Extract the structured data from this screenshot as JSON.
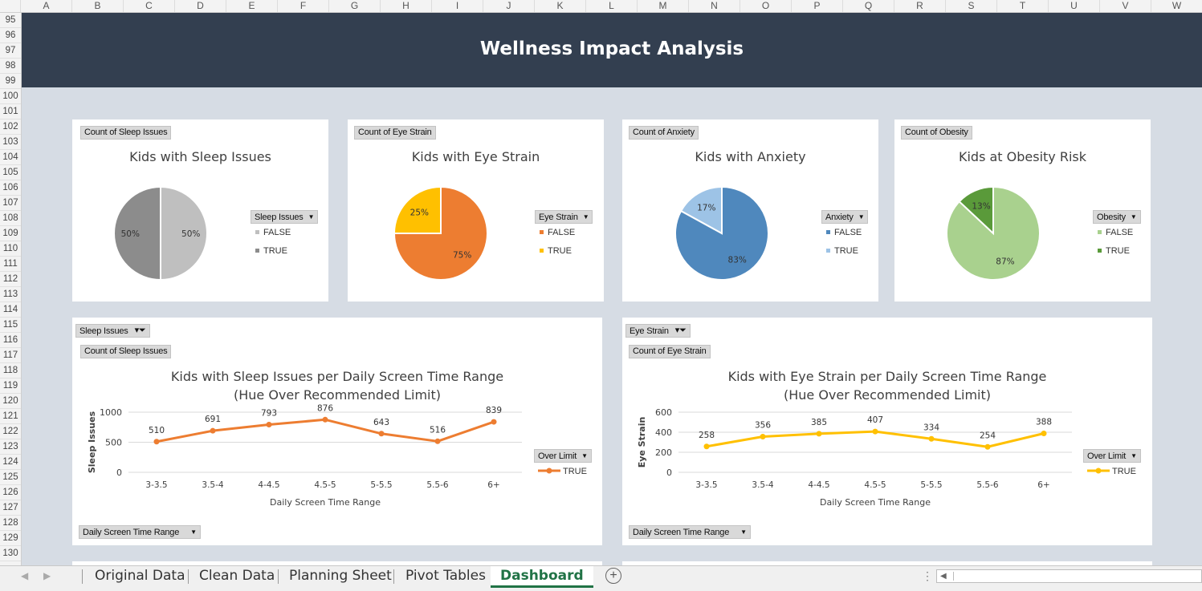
{
  "columns": [
    "A",
    "B",
    "C",
    "D",
    "E",
    "F",
    "G",
    "H",
    "I",
    "J",
    "K",
    "L",
    "M",
    "N",
    "O",
    "P",
    "Q",
    "R",
    "S",
    "T",
    "U",
    "V",
    "W"
  ],
  "rows": [
    "95",
    "96",
    "97",
    "98",
    "99",
    "100",
    "101",
    "102",
    "103",
    "104",
    "105",
    "106",
    "107",
    "108",
    "109",
    "110",
    "111",
    "112",
    "113",
    "114",
    "115",
    "116",
    "117",
    "118",
    "119",
    "120",
    "121",
    "122",
    "123",
    "124",
    "125",
    "126",
    "127",
    "128",
    "129",
    "130"
  ],
  "dashboard": {
    "title": "Wellness Impact Analysis"
  },
  "pies": [
    {
      "field_label": "Count of Sleep Issues",
      "title": "Kids with Sleep Issues",
      "legend_title": "Sleep Issues",
      "chart_data": {
        "type": "pie",
        "categories": [
          "FALSE",
          "TRUE"
        ],
        "values": [
          50,
          50
        ],
        "labels": [
          "50%",
          "50%"
        ],
        "colors": [
          "#bfbfbf",
          "#8c8c8c"
        ]
      }
    },
    {
      "field_label": "Count of Eye Strain",
      "title": "Kids with Eye Strain",
      "legend_title": "Eye Strain",
      "chart_data": {
        "type": "pie",
        "categories": [
          "FALSE",
          "TRUE"
        ],
        "values": [
          75,
          25
        ],
        "labels": [
          "75%",
          "25%"
        ],
        "colors": [
          "#ed7d31",
          "#ffc000"
        ]
      }
    },
    {
      "field_label": "Count of Anxiety",
      "title": "Kids with Anxiety",
      "legend_title": "Anxiety",
      "chart_data": {
        "type": "pie",
        "categories": [
          "FALSE",
          "TRUE"
        ],
        "values": [
          83,
          17
        ],
        "labels": [
          "83%",
          "17%"
        ],
        "colors": [
          "#4f88bd",
          "#9dc3e6"
        ]
      }
    },
    {
      "field_label": "Count of Obesity",
      "title": "Kids at Obesity Risk",
      "legend_title": "Obesity",
      "chart_data": {
        "type": "pie",
        "categories": [
          "FALSE",
          "TRUE"
        ],
        "values": [
          87,
          13
        ],
        "labels": [
          "87%",
          "13%"
        ],
        "colors": [
          "#a9d18e",
          "#5a9a3a"
        ]
      }
    }
  ],
  "lines": [
    {
      "filter_label": "Sleep Issues",
      "field_label": "Count of Sleep Issues",
      "title_line1": "Kids with Sleep Issues per Daily Screen Time Range",
      "title_line2": "(Hue Over Recommended Limit)",
      "legend_title": "Over Limit",
      "axis_button": "Daily Screen Time Range",
      "chart_data": {
        "type": "line",
        "categories": [
          "3-3.5",
          "3.5-4",
          "4-4.5",
          "4.5-5",
          "5-5.5",
          "5.5-6",
          "6+"
        ],
        "series": [
          {
            "name": "TRUE",
            "values": [
              510,
              691,
              793,
              876,
              643,
              516,
              839
            ]
          }
        ],
        "xlabel": "Daily Screen Time Range",
        "ylabel": "Sleep Issues",
        "ylim": [
          0,
          1000
        ],
        "yticks": [
          0,
          500,
          1000
        ],
        "yticklabels": [
          "0",
          "500",
          "1000"
        ],
        "grid": true,
        "legend": "right",
        "color": "#ed7d31"
      }
    },
    {
      "filter_label": "Eye Strain",
      "field_label": "Count of Eye Strain",
      "title_line1": "Kids with Eye Strain per Daily Screen Time Range",
      "title_line2": "(Hue Over Recommended Limit)",
      "legend_title": "Over Limit",
      "axis_button": "Daily Screen Time Range",
      "chart_data": {
        "type": "line",
        "categories": [
          "3-3.5",
          "3.5-4",
          "4-4.5",
          "4.5-5",
          "5-5.5",
          "5.5-6",
          "6+"
        ],
        "series": [
          {
            "name": "TRUE",
            "values": [
              258,
              356,
              385,
              407,
              334,
              254,
              388
            ]
          }
        ],
        "xlabel": "Daily Screen Time Range",
        "ylabel": "Eye Strain",
        "ylim": [
          0,
          600
        ],
        "yticks": [
          0,
          200,
          400,
          600
        ],
        "yticklabels": [
          "0",
          "200",
          "400",
          "600"
        ],
        "grid": true,
        "legend": "right",
        "color": "#ffc000"
      }
    }
  ],
  "tabs": [
    "Original Data",
    "Clean Data",
    "Planning Sheet",
    "Pivot Tables",
    "Dashboard"
  ],
  "active_tab": "Dashboard",
  "icons": {
    "add_sheet": "plus-circle-icon",
    "prev": "chevron-left-icon",
    "next": "chevron-right-icon",
    "options": "vertical-ellipsis-icon",
    "scroll_left": "scroll-left-icon",
    "filter": "funnel-icon",
    "dropdown": "dropdown-icon"
  }
}
